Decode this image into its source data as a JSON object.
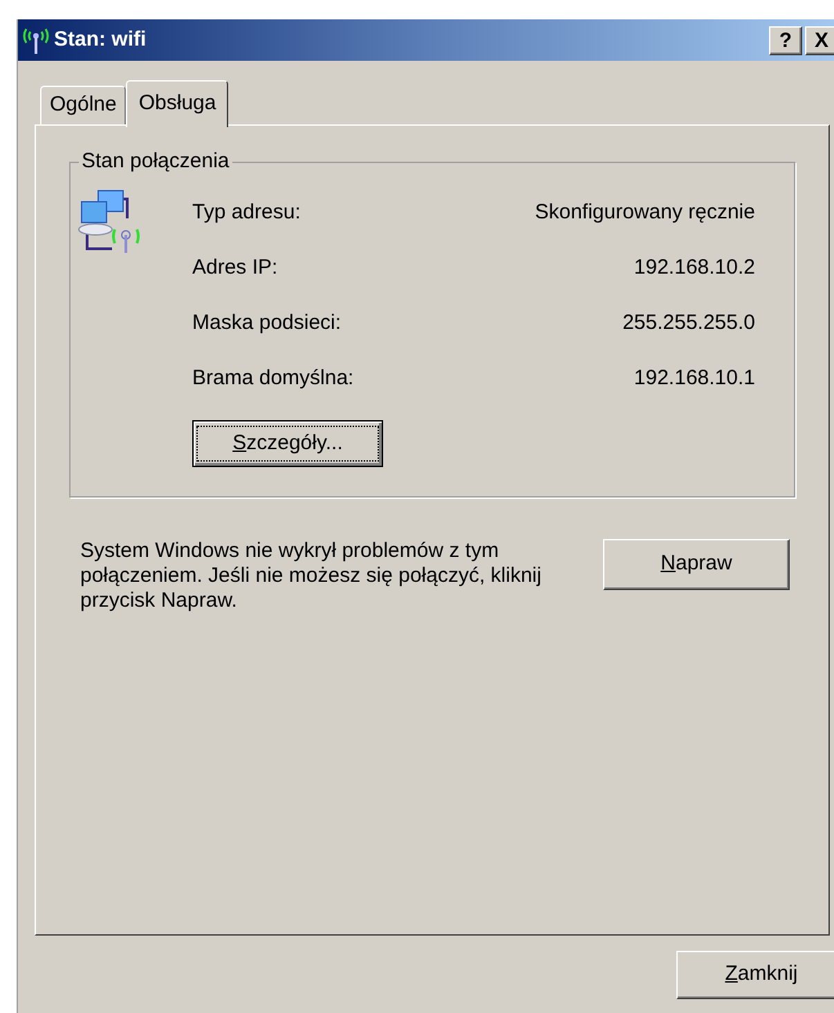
{
  "window": {
    "title": "Stan: wifi",
    "title_buttons": [
      "?",
      "X"
    ]
  },
  "tabs": [
    {
      "label": "Ogólne",
      "selected": false
    },
    {
      "label": "Obsługa",
      "selected": true
    }
  ],
  "group": {
    "title": "Stan połączenia",
    "rows": [
      {
        "label": "Typ adresu:",
        "value": "Skonfigurowany ręcznie"
      },
      {
        "label": "Adres IP:",
        "value": "192.168.10.2"
      },
      {
        "label": "Maska podsieci:",
        "value": "255.255.255.0"
      },
      {
        "label": "Brama domyślna:",
        "value": "192.168.10.1"
      }
    ],
    "details_button": "Szczegóły..."
  },
  "repair": {
    "message": "System Windows nie wykrył problemów z tym połączeniem. Jeśli nie możesz się połączyć, kliknij przycisk Napraw.",
    "button": "Napraw"
  },
  "close_button": "Zamknij"
}
